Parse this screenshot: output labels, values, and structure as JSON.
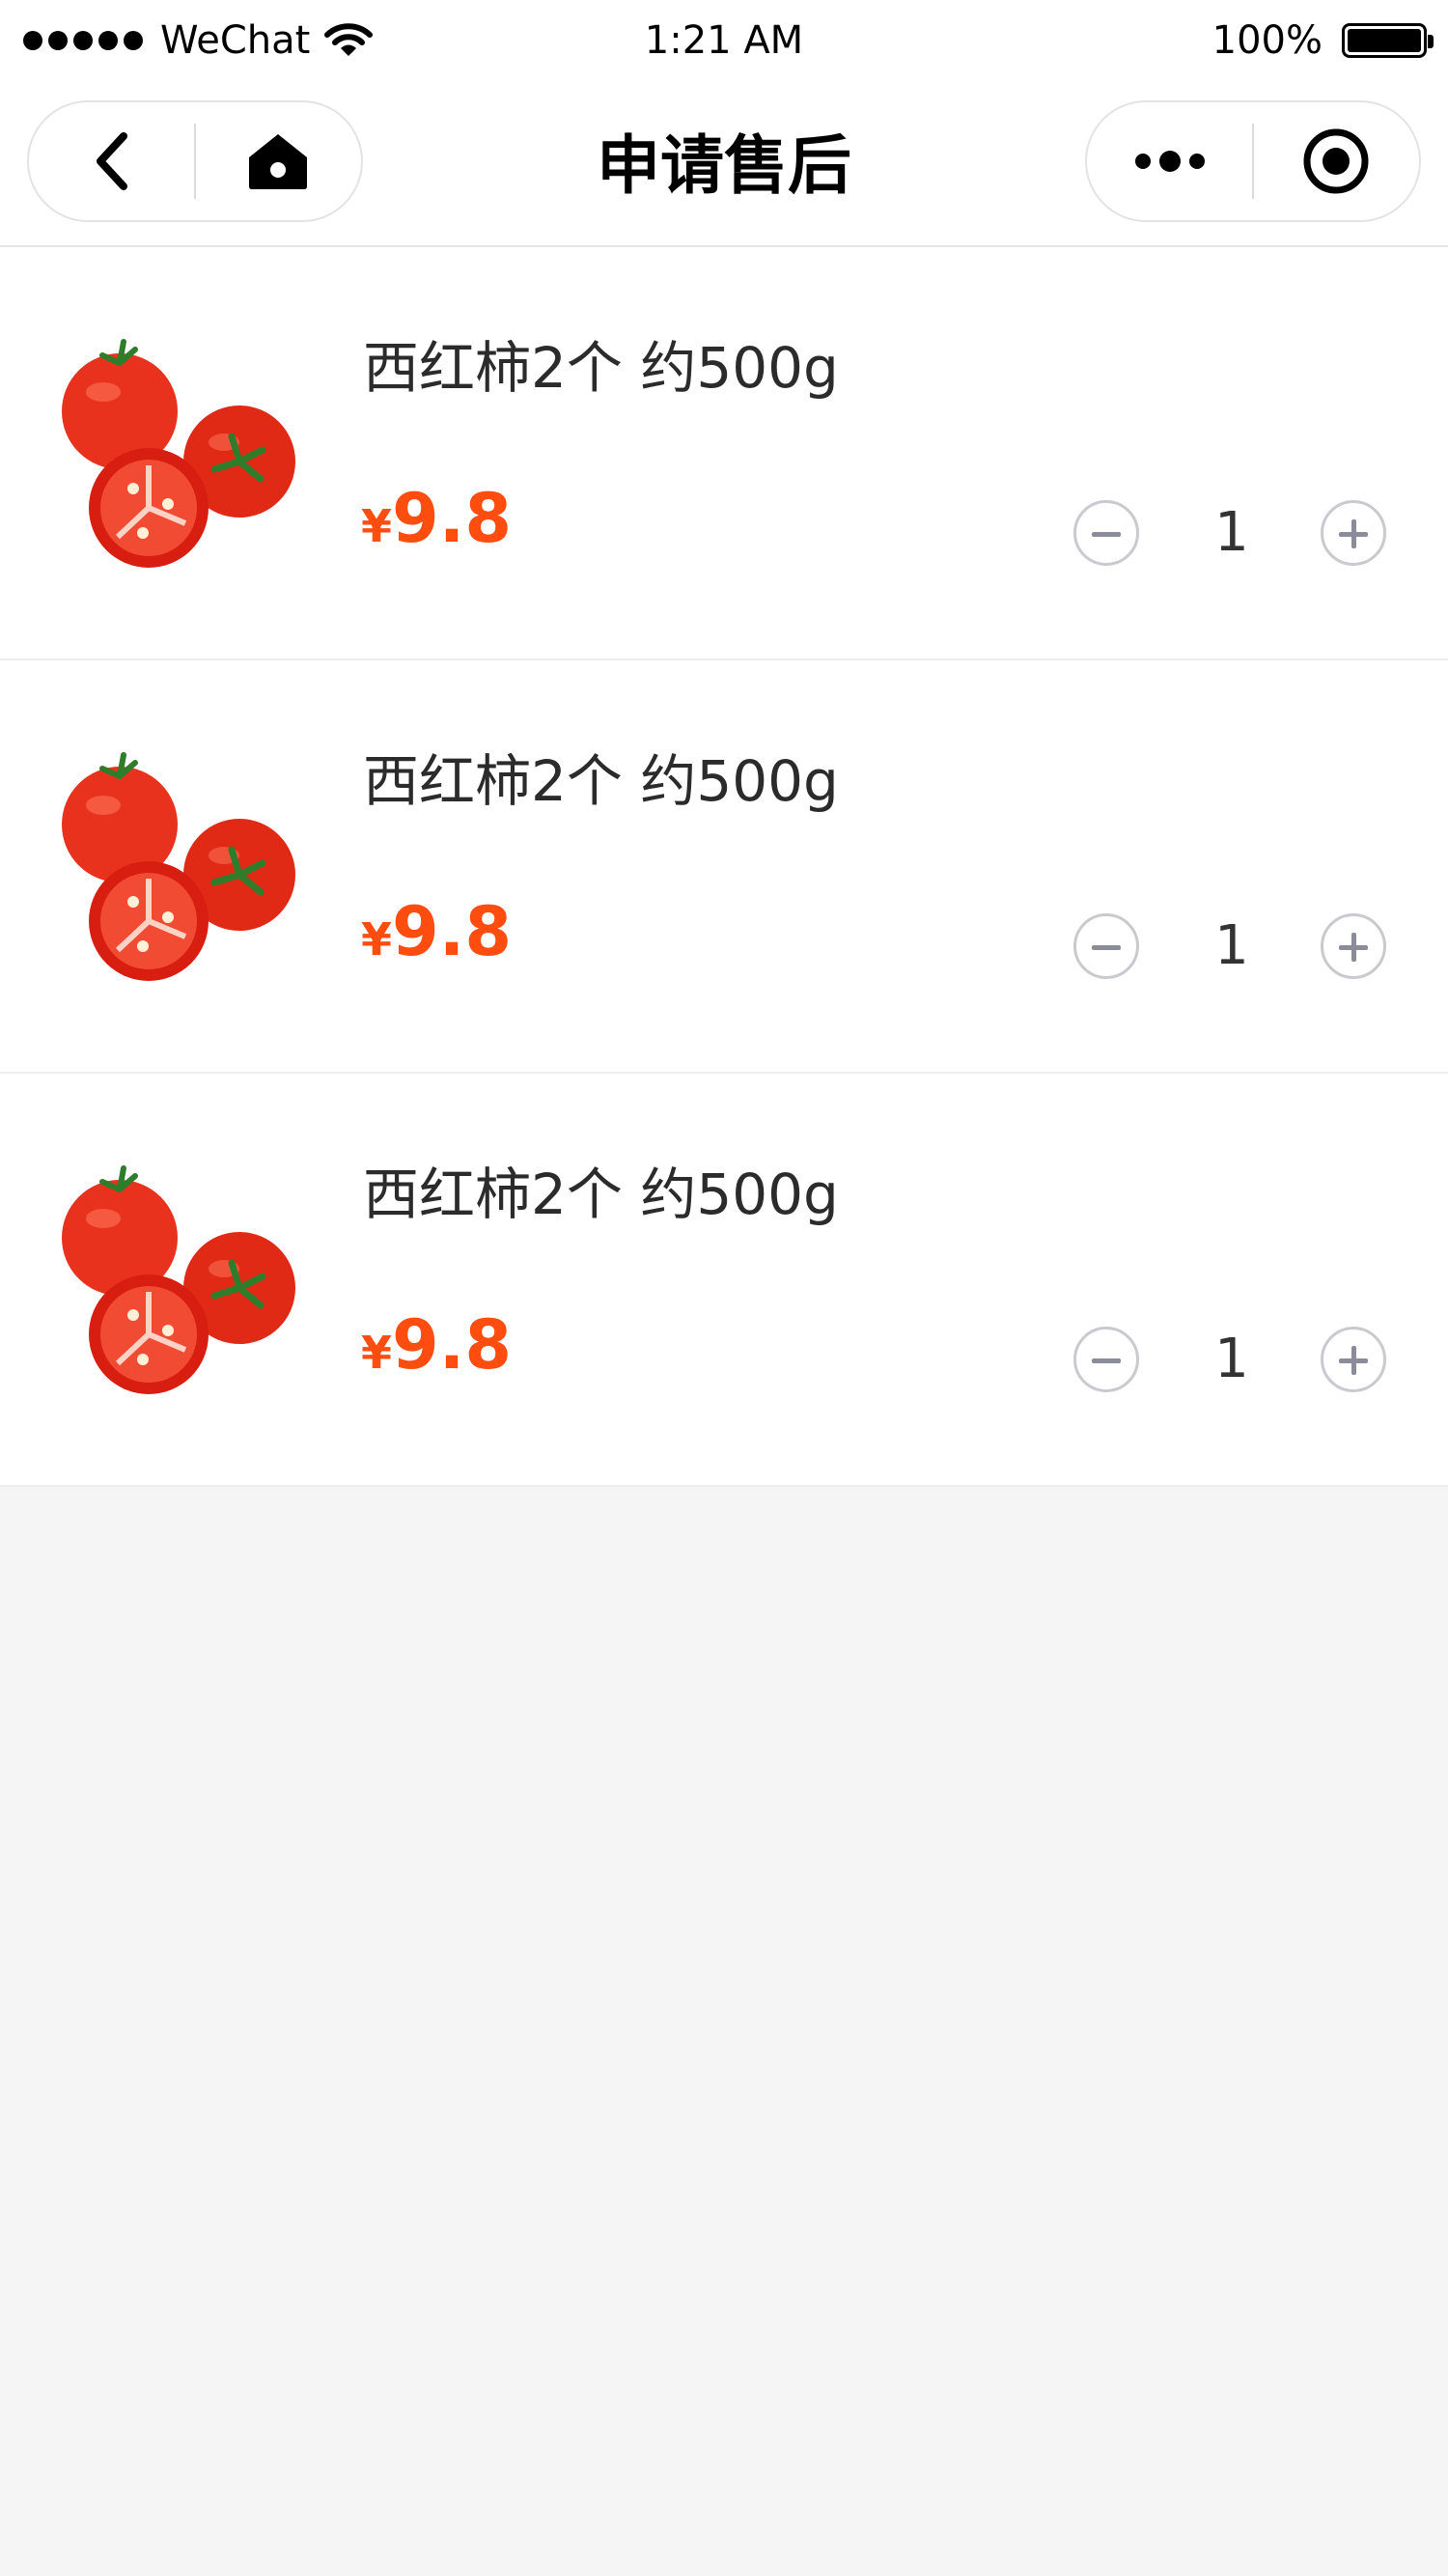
{
  "status_bar": {
    "carrier": "WeChat",
    "time": "1:21 AM",
    "battery_percent": "100%"
  },
  "nav": {
    "title": "申请售后",
    "left_icons": [
      "back-icon",
      "home-icon"
    ],
    "right_icons": [
      "more-icon",
      "close-miniprogram-icon"
    ]
  },
  "items": [
    {
      "name": "西红柿2个 约500g",
      "currency": "¥",
      "price": "9.8",
      "quantity": "1"
    },
    {
      "name": "西红柿2个 约500g",
      "currency": "¥",
      "price": "9.8",
      "quantity": "1"
    },
    {
      "name": "西红柿2个 约500g",
      "currency": "¥",
      "price": "9.8",
      "quantity": "1"
    }
  ],
  "colors": {
    "price": "#ff4d0f",
    "background": "#f5f5f5",
    "stepper_border": "#c9c9cf"
  }
}
